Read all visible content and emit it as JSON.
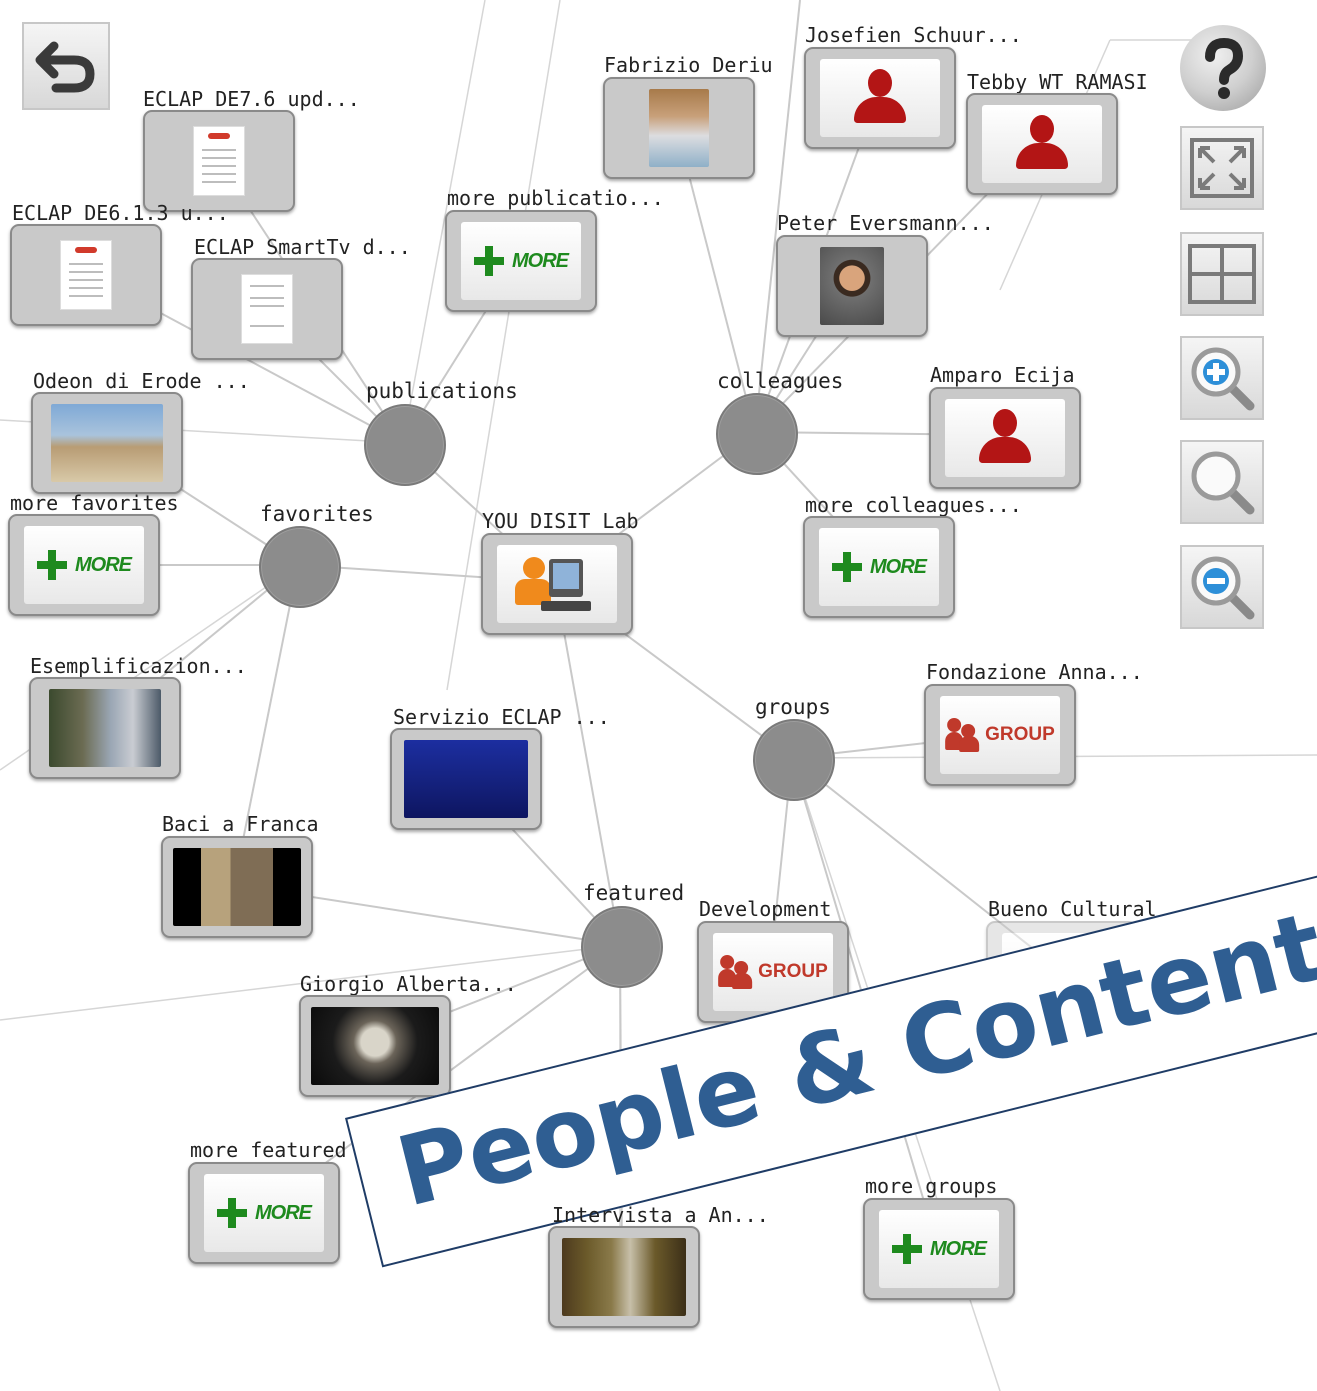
{
  "center": {
    "label": "YOU DISIT Lab"
  },
  "hubs": {
    "publications": "publications",
    "colleagues": "colleagues",
    "favorites": "favorites",
    "groups": "groups",
    "featured": "featured"
  },
  "nodes": {
    "eclap_de76": "ECLAP DE7.6 upd...",
    "eclap_de613": "ECLAP DE6.1.3 u...",
    "eclap_smarttv": "ECLAP SmartTv d...",
    "more_publications": "more publicatio...",
    "fabrizio": "Fabrizio Deriu",
    "josefien": "Josefien Schuur...",
    "tebby": "Tebby WT RAMASI",
    "peter": "Peter Eversmann...",
    "amparo": "Amparo Ecija",
    "more_colleagues": "more colleagues...",
    "odeon": "Odeon di Erode ...",
    "more_favorites": "more favorites",
    "esemplificazion": "Esemplificazion...",
    "servizio": "Servizio ECLAP ...",
    "baci": "Baci a Franca",
    "giorgio": "Giorgio Alberta...",
    "more_featured": "more featured",
    "intervista": "Intervista a An...",
    "fondazione": "Fondazione Anna...",
    "development": "Development",
    "bueno": "Bueno Cultural ...",
    "more_groups": "more groups"
  },
  "badges": {
    "more": "MORE",
    "group": "GROUP"
  },
  "icons": {
    "back": "undo-arrow-icon",
    "help": "question-mark-icon",
    "fit": "fit-to-screen-icon",
    "grid": "grid-icon",
    "zoom_in": "zoom-in-icon",
    "zoom_reset": "zoom-reset-icon",
    "zoom_out": "zoom-out-icon"
  },
  "colors": {
    "hub": "#8c8c8c",
    "person": "#b31515",
    "more": "#1e8a1e",
    "group": "#c0392b",
    "banner": "#2f5e92"
  },
  "banner": {
    "text": "People & Content Aggregation"
  }
}
